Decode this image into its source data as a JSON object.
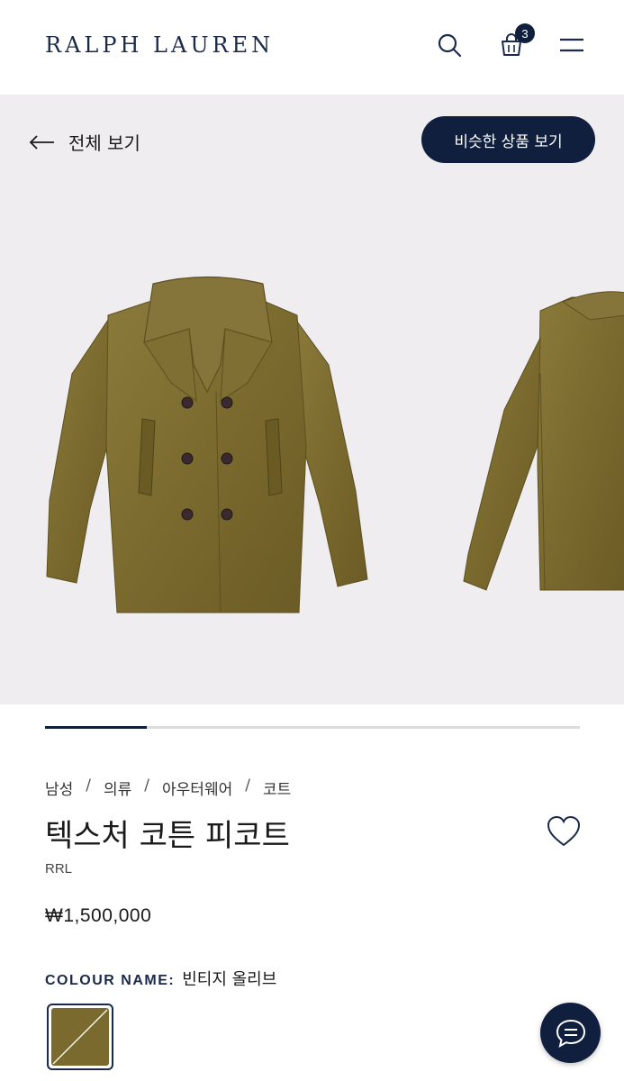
{
  "header": {
    "logo": "RALPH LAUREN",
    "cart_count": "3",
    "icons": [
      "search-icon",
      "shopping-bag-icon",
      "menu-icon"
    ]
  },
  "gallery": {
    "back_label": "전체 보기",
    "similar_button": "비슷한 상품 보기",
    "progress": 0.19
  },
  "product": {
    "breadcrumb": [
      "남성",
      "의류",
      "아우터웨어",
      "코트"
    ],
    "breadcrumb_separator": "/",
    "title": "텍스처 코튼 피코트",
    "brand": "RRL",
    "price": "₩1,500,000",
    "colour_label": "COLOUR NAME:",
    "colour_value": "빈티지 올리브"
  },
  "colors": {
    "navy": "#0f1f3d",
    "gallery_bg": "#efedef",
    "olive": "#7a6a2e"
  }
}
